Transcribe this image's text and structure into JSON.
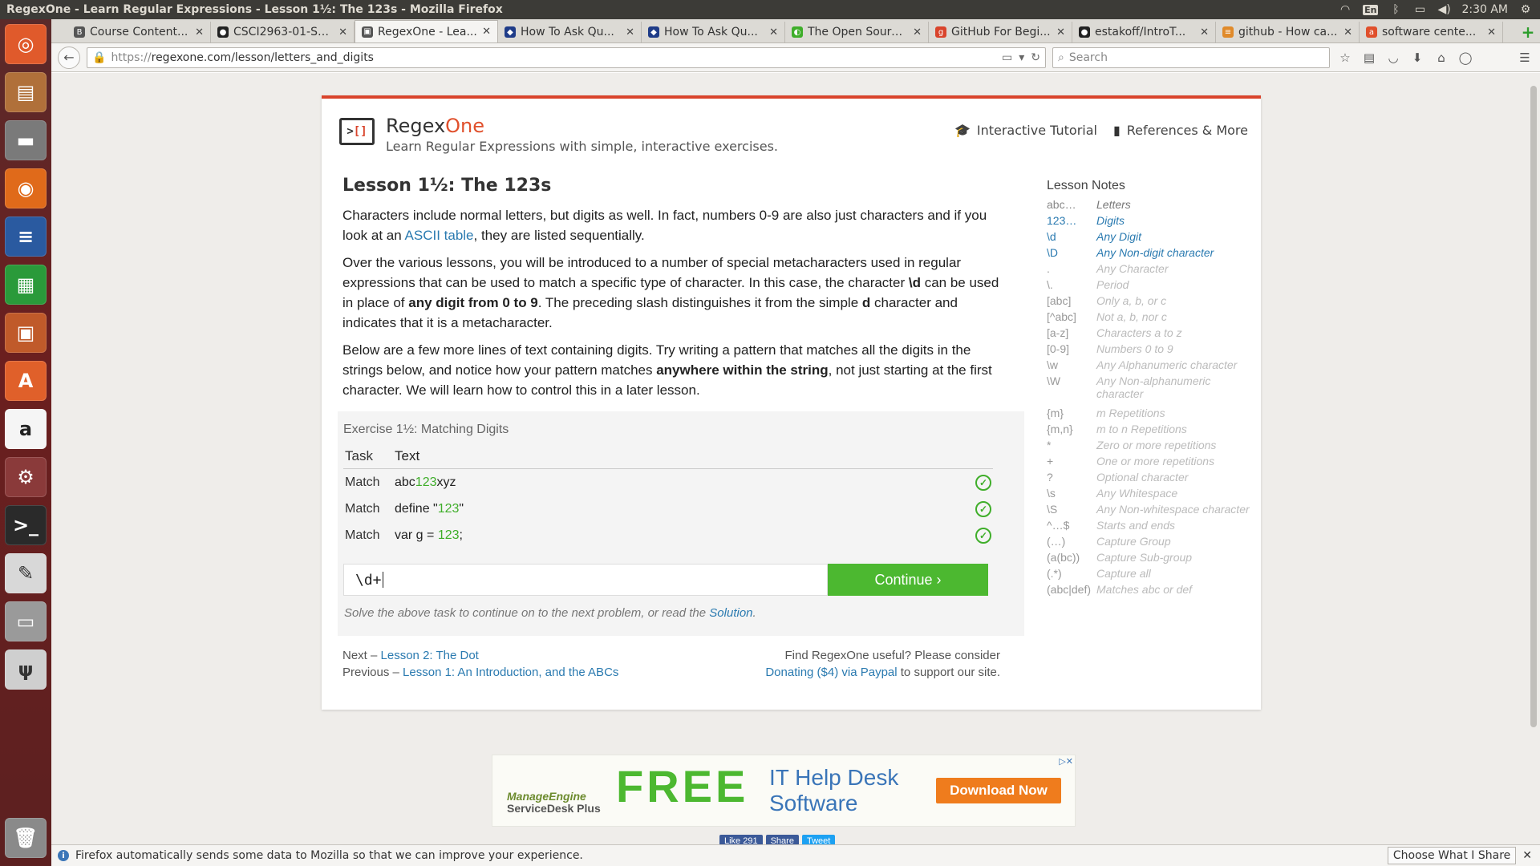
{
  "window": {
    "title": "RegexOne - Learn Regular Expressions - Lesson 1½: The 123s - Mozilla Firefox"
  },
  "tray": {
    "lang": "En",
    "time": "2:30 AM"
  },
  "tabs": [
    {
      "label": "Course Content...",
      "fav_color": "#555555"
    },
    {
      "label": "CSCI2963-01-Sp...",
      "fav_color": "#222222"
    },
    {
      "label": "RegexOne - Lea...",
      "fav_color": "#555555"
    },
    {
      "label": "How To Ask Qu...",
      "fav_color": "#1f3c88"
    },
    {
      "label": "How To Ask Qu...",
      "fav_color": "#1f3c88"
    },
    {
      "label": "The Open Sourc...",
      "fav_color": "#3fae2a"
    },
    {
      "label": "GitHub For Begi...",
      "fav_color": "#d9442c"
    },
    {
      "label": "estakoff/IntroT...",
      "fav_color": "#222222"
    },
    {
      "label": "github - How ca...",
      "fav_color": "#e08a2a"
    },
    {
      "label": "software cente...",
      "fav_color": "#e0502c"
    }
  ],
  "navbar": {
    "url_proto": "https://",
    "url_rest": "regexone.com/lesson/letters_and_digits",
    "search_placeholder": "Search"
  },
  "site": {
    "brand_prefix": "Regex",
    "brand_suffix": "One",
    "tagline": "Learn Regular Expressions with simple, interactive exercises.",
    "link_tutorial": "Interactive Tutorial",
    "link_refs": "References & More"
  },
  "lesson": {
    "title": "Lesson 1½: The 123s",
    "p1_a": "Characters include normal letters, but digits as well. In fact, numbers 0-9 are also just characters and if you look at an ",
    "p1_link": "ASCII table",
    "p1_b": ", they are listed sequentially.",
    "p2_a": "Over the various lessons, you will be introduced to a number of special metacharacters used in regular expressions that can be used to match a specific type of character. In this case, the character ",
    "p2_code": "\\d",
    "p2_b": " can be used in place of ",
    "p2_bold": "any digit from 0 to 9",
    "p2_c": ". The preceding slash distinguishes it from the simple ",
    "p2_d": "d",
    "p2_e": " character and indicates that it is a metacharacter.",
    "p3_a": "Below are a few more lines of text containing digits. Try writing a pattern that matches all the digits in the strings below, and notice how your pattern matches ",
    "p3_bold": "anywhere within the string",
    "p3_b": ", not just starting at the first character. We will learn how to control this in a later lesson."
  },
  "exercise": {
    "title": "Exercise 1½: Matching Digits",
    "col_task": "Task",
    "col_text": "Text",
    "rows": [
      {
        "task": "Match",
        "pre": "abc",
        "match": "123",
        "post": "xyz"
      },
      {
        "task": "Match",
        "pre": "define \"",
        "match": "123",
        "post": "\""
      },
      {
        "task": "Match",
        "pre": "var g = ",
        "match": "123",
        "post": ";"
      }
    ],
    "input_value": "\\d+",
    "continue_label": "Continue ›",
    "hint_pre": "Solve the above task to continue on to the next problem, or read the ",
    "hint_link": "Solution",
    "hint_post": "."
  },
  "footer": {
    "next_prefix": "Next – ",
    "next_link": "Lesson 2: The Dot",
    "prev_prefix": "Previous – ",
    "prev_link": "Lesson 1: An Introduction, and the ABCs",
    "donate_line1": "Find RegexOne useful? Please consider",
    "donate_link": "Donating ($4) via Paypal",
    "donate_post": " to support our site."
  },
  "notes": {
    "title": "Lesson Notes",
    "items": [
      {
        "k": "abc…",
        "v": "Letters",
        "state": "done"
      },
      {
        "k": "123…",
        "v": "Digits",
        "state": "active"
      },
      {
        "k": "\\d",
        "v": "Any Digit",
        "state": "active"
      },
      {
        "k": "\\D",
        "v": "Any Non-digit character",
        "state": "active"
      },
      {
        "k": ".",
        "v": "Any Character",
        "state": ""
      },
      {
        "k": "\\.",
        "v": "Period",
        "state": ""
      },
      {
        "k": "[abc]",
        "v": "Only a, b, or c",
        "state": ""
      },
      {
        "k": "[^abc]",
        "v": "Not a, b, nor c",
        "state": ""
      },
      {
        "k": "[a-z]",
        "v": "Characters a to z",
        "state": ""
      },
      {
        "k": "[0-9]",
        "v": "Numbers 0 to 9",
        "state": ""
      },
      {
        "k": "\\w",
        "v": "Any Alphanumeric character",
        "state": ""
      },
      {
        "k": "\\W",
        "v": "Any Non-alphanumeric character",
        "state": "wrap"
      },
      {
        "k": "{m}",
        "v": "m Repetitions",
        "state": ""
      },
      {
        "k": "{m,n}",
        "v": "m to n Repetitions",
        "state": ""
      },
      {
        "k": "*",
        "v": "Zero or more repetitions",
        "state": ""
      },
      {
        "k": "+",
        "v": "One or more repetitions",
        "state": ""
      },
      {
        "k": "?",
        "v": "Optional character",
        "state": ""
      },
      {
        "k": "\\s",
        "v": "Any Whitespace",
        "state": ""
      },
      {
        "k": "\\S",
        "v": "Any Non-whitespace character",
        "state": ""
      },
      {
        "k": "^…$",
        "v": "Starts and ends",
        "state": ""
      },
      {
        "k": "(…)",
        "v": "Capture Group",
        "state": ""
      },
      {
        "k": "(a(bc))",
        "v": "Capture Sub-group",
        "state": ""
      },
      {
        "k": "(.*)",
        "v": "Capture all",
        "state": ""
      },
      {
        "k": "(abc|def)",
        "v": "Matches abc or def",
        "state": ""
      }
    ]
  },
  "ad": {
    "brand_top": "ManageEngine",
    "brand_bottom": "ServiceDesk Plus",
    "free": "FREE",
    "headline_1": "IT Help Desk",
    "headline_2": "Software",
    "cta": "Download Now"
  },
  "social": {
    "like": "Like 291",
    "share": "Share",
    "tweet": "Tweet"
  },
  "notice": {
    "text": "Firefox automatically sends some data to Mozilla so that we can improve your experience.",
    "button": "Choose What I Share"
  }
}
